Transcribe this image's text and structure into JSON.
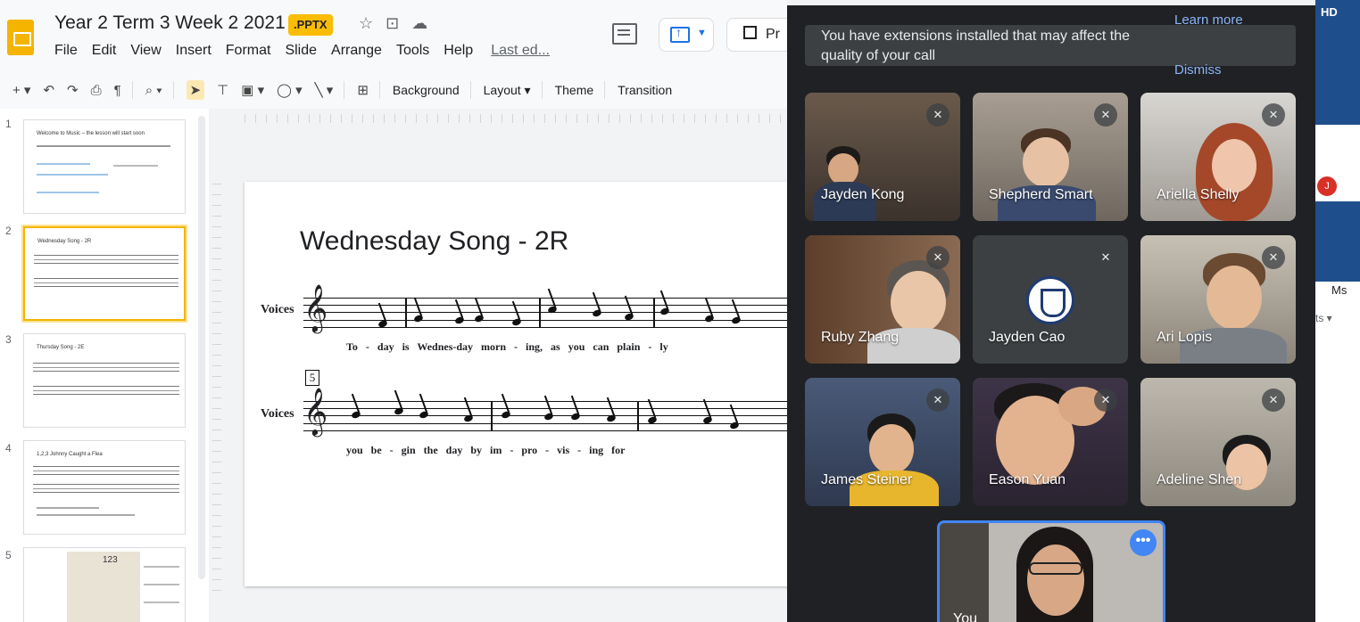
{
  "slides": {
    "doc_title": "Year 2 Term 3 Week 2 2021",
    "badge": ".PPTX",
    "menu": [
      "File",
      "Edit",
      "View",
      "Insert",
      "Format",
      "Slide",
      "Arrange",
      "Tools",
      "Help"
    ],
    "last_edit": "Last ed...",
    "present_label": "Pr",
    "toolbar": {
      "background": "Background",
      "layout": "Layout",
      "theme": "Theme",
      "transition": "Transition"
    },
    "thumbnails": [
      {
        "num": "1",
        "title": "Welcome to Music – the lesson will start soon"
      },
      {
        "num": "2",
        "title": "Wednesday Song - 2R"
      },
      {
        "num": "3",
        "title": "Thursday Song - 2E"
      },
      {
        "num": "4",
        "title": "1,2,3 Johnny Caught a Flea"
      },
      {
        "num": "5",
        "title": "123"
      }
    ],
    "slide": {
      "title": "Wednesday Song - 2R",
      "voices_label": "Voices",
      "bar_number": "5",
      "lyrics_line1": "To - day is Wednes-day morn - ing, as you can plain - ly",
      "lyrics_line2": "you be - gin the day by im - pro - vis - ing for"
    }
  },
  "meet": {
    "banner_text": "You have extensions installed that may affect the quality of your call",
    "learn_more": "Learn more",
    "dismiss": "Dismiss",
    "participants": [
      {
        "name": "Jayden Kong"
      },
      {
        "name": "Shepherd Smart"
      },
      {
        "name": "Ariella Shelly"
      },
      {
        "name": "Ruby Zhang"
      },
      {
        "name": "Jayden Cao"
      },
      {
        "name": "Ari Lopis"
      },
      {
        "name": "James Steiner"
      },
      {
        "name": "Eason Yuan"
      },
      {
        "name": "Adeline Shen"
      }
    ],
    "self_label": "You"
  },
  "background_app": {
    "top_label": "HD",
    "avatar_initial": "J",
    "ms_label": "Ms",
    "ts_label": "ts ▾"
  },
  "colors": {
    "slides_yellow": "#f4b400",
    "meet_bg": "#202124",
    "link_blue": "#8ab4f8",
    "self_border": "#4285f4"
  }
}
